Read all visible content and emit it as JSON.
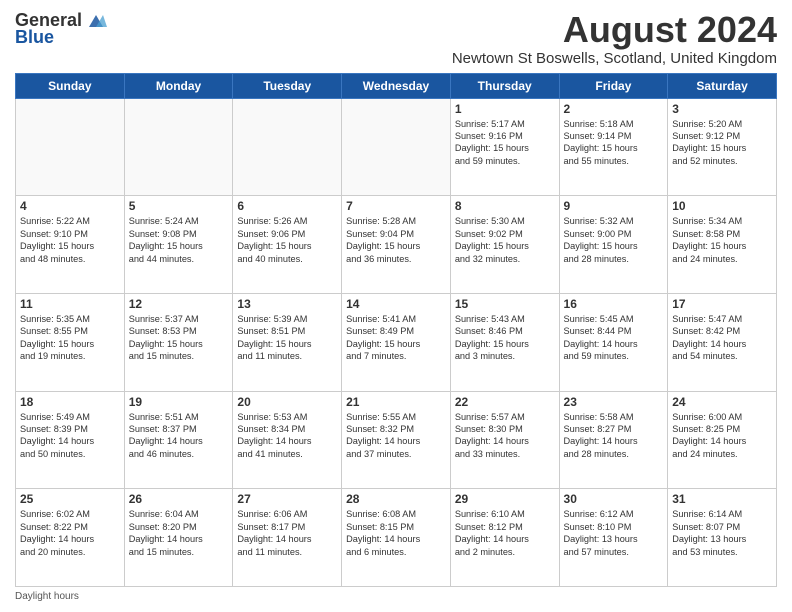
{
  "header": {
    "logo_general": "General",
    "logo_blue": "Blue",
    "month_year": "August 2024",
    "location": "Newtown St Boswells, Scotland, United Kingdom"
  },
  "days_of_week": [
    "Sunday",
    "Monday",
    "Tuesday",
    "Wednesday",
    "Thursday",
    "Friday",
    "Saturday"
  ],
  "weeks": [
    [
      {
        "day": "",
        "info": ""
      },
      {
        "day": "",
        "info": ""
      },
      {
        "day": "",
        "info": ""
      },
      {
        "day": "",
        "info": ""
      },
      {
        "day": "1",
        "info": "Sunrise: 5:17 AM\nSunset: 9:16 PM\nDaylight: 15 hours\nand 59 minutes."
      },
      {
        "day": "2",
        "info": "Sunrise: 5:18 AM\nSunset: 9:14 PM\nDaylight: 15 hours\nand 55 minutes."
      },
      {
        "day": "3",
        "info": "Sunrise: 5:20 AM\nSunset: 9:12 PM\nDaylight: 15 hours\nand 52 minutes."
      }
    ],
    [
      {
        "day": "4",
        "info": "Sunrise: 5:22 AM\nSunset: 9:10 PM\nDaylight: 15 hours\nand 48 minutes."
      },
      {
        "day": "5",
        "info": "Sunrise: 5:24 AM\nSunset: 9:08 PM\nDaylight: 15 hours\nand 44 minutes."
      },
      {
        "day": "6",
        "info": "Sunrise: 5:26 AM\nSunset: 9:06 PM\nDaylight: 15 hours\nand 40 minutes."
      },
      {
        "day": "7",
        "info": "Sunrise: 5:28 AM\nSunset: 9:04 PM\nDaylight: 15 hours\nand 36 minutes."
      },
      {
        "day": "8",
        "info": "Sunrise: 5:30 AM\nSunset: 9:02 PM\nDaylight: 15 hours\nand 32 minutes."
      },
      {
        "day": "9",
        "info": "Sunrise: 5:32 AM\nSunset: 9:00 PM\nDaylight: 15 hours\nand 28 minutes."
      },
      {
        "day": "10",
        "info": "Sunrise: 5:34 AM\nSunset: 8:58 PM\nDaylight: 15 hours\nand 24 minutes."
      }
    ],
    [
      {
        "day": "11",
        "info": "Sunrise: 5:35 AM\nSunset: 8:55 PM\nDaylight: 15 hours\nand 19 minutes."
      },
      {
        "day": "12",
        "info": "Sunrise: 5:37 AM\nSunset: 8:53 PM\nDaylight: 15 hours\nand 15 minutes."
      },
      {
        "day": "13",
        "info": "Sunrise: 5:39 AM\nSunset: 8:51 PM\nDaylight: 15 hours\nand 11 minutes."
      },
      {
        "day": "14",
        "info": "Sunrise: 5:41 AM\nSunset: 8:49 PM\nDaylight: 15 hours\nand 7 minutes."
      },
      {
        "day": "15",
        "info": "Sunrise: 5:43 AM\nSunset: 8:46 PM\nDaylight: 15 hours\nand 3 minutes."
      },
      {
        "day": "16",
        "info": "Sunrise: 5:45 AM\nSunset: 8:44 PM\nDaylight: 14 hours\nand 59 minutes."
      },
      {
        "day": "17",
        "info": "Sunrise: 5:47 AM\nSunset: 8:42 PM\nDaylight: 14 hours\nand 54 minutes."
      }
    ],
    [
      {
        "day": "18",
        "info": "Sunrise: 5:49 AM\nSunset: 8:39 PM\nDaylight: 14 hours\nand 50 minutes."
      },
      {
        "day": "19",
        "info": "Sunrise: 5:51 AM\nSunset: 8:37 PM\nDaylight: 14 hours\nand 46 minutes."
      },
      {
        "day": "20",
        "info": "Sunrise: 5:53 AM\nSunset: 8:34 PM\nDaylight: 14 hours\nand 41 minutes."
      },
      {
        "day": "21",
        "info": "Sunrise: 5:55 AM\nSunset: 8:32 PM\nDaylight: 14 hours\nand 37 minutes."
      },
      {
        "day": "22",
        "info": "Sunrise: 5:57 AM\nSunset: 8:30 PM\nDaylight: 14 hours\nand 33 minutes."
      },
      {
        "day": "23",
        "info": "Sunrise: 5:58 AM\nSunset: 8:27 PM\nDaylight: 14 hours\nand 28 minutes."
      },
      {
        "day": "24",
        "info": "Sunrise: 6:00 AM\nSunset: 8:25 PM\nDaylight: 14 hours\nand 24 minutes."
      }
    ],
    [
      {
        "day": "25",
        "info": "Sunrise: 6:02 AM\nSunset: 8:22 PM\nDaylight: 14 hours\nand 20 minutes."
      },
      {
        "day": "26",
        "info": "Sunrise: 6:04 AM\nSunset: 8:20 PM\nDaylight: 14 hours\nand 15 minutes."
      },
      {
        "day": "27",
        "info": "Sunrise: 6:06 AM\nSunset: 8:17 PM\nDaylight: 14 hours\nand 11 minutes."
      },
      {
        "day": "28",
        "info": "Sunrise: 6:08 AM\nSunset: 8:15 PM\nDaylight: 14 hours\nand 6 minutes."
      },
      {
        "day": "29",
        "info": "Sunrise: 6:10 AM\nSunset: 8:12 PM\nDaylight: 14 hours\nand 2 minutes."
      },
      {
        "day": "30",
        "info": "Sunrise: 6:12 AM\nSunset: 8:10 PM\nDaylight: 13 hours\nand 57 minutes."
      },
      {
        "day": "31",
        "info": "Sunrise: 6:14 AM\nSunset: 8:07 PM\nDaylight: 13 hours\nand 53 minutes."
      }
    ]
  ],
  "footer": {
    "daylight_label": "Daylight hours"
  }
}
